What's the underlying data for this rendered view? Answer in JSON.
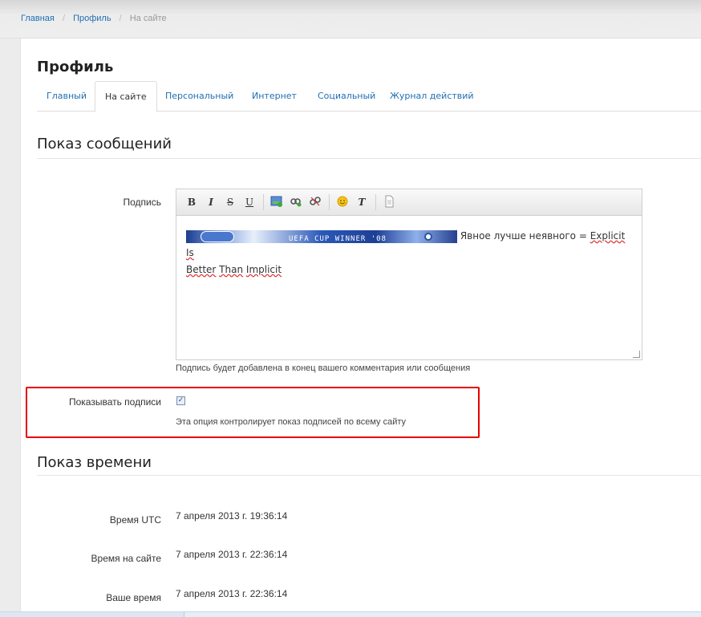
{
  "breadcrumb": {
    "home": "Главная",
    "profile": "Профиль",
    "current": "На сайте",
    "separator": "/"
  },
  "page": {
    "title": "Профиль"
  },
  "tabs": [
    {
      "label": "Главный"
    },
    {
      "label": "На сайте"
    },
    {
      "label": "Персональный"
    },
    {
      "label": "Интернет"
    },
    {
      "label": "Социальный"
    },
    {
      "label": "Журнал действий"
    }
  ],
  "messages_section": {
    "title": "Показ сообщений",
    "signature_label": "Подпись",
    "toolbar": {
      "bold": "B",
      "italic": "I",
      "strike": "S",
      "underline": "U",
      "image": "image-icon",
      "link": "link-icon",
      "unlink": "unlink-icon",
      "smiley": "smiley-icon",
      "clear_format": "T",
      "source": "document-icon"
    },
    "banner_text": "UEFA CUP WINNER '08",
    "signature_text_1": "Явное лучше неявного = ",
    "signature_word_explicit": "Explicit",
    "signature_word_is": "Is",
    "signature_word_better": "Better",
    "signature_word_than": "Than",
    "signature_word_implicit": "Implicit",
    "signature_hint": "Подпись будет добавлена в конец вашего комментария или сообщения",
    "show_signatures_label": "Показывать подписи",
    "show_signatures_checked": true,
    "show_signatures_hint": "Эта опция контролирует показ подписей по всему сайту"
  },
  "time_section": {
    "title": "Показ времени",
    "rows": [
      {
        "label": "Время UTC",
        "value": "7 апреля 2013 г. 19:36:14"
      },
      {
        "label": "Время на сайте",
        "value": "7 апреля 2013 г. 22:36:14"
      },
      {
        "label": "Ваше время",
        "value": "7 апреля 2013 г. 22:36:14"
      }
    ]
  },
  "colors": {
    "link": "#1f6fb2",
    "highlight_border": "#e60000"
  }
}
